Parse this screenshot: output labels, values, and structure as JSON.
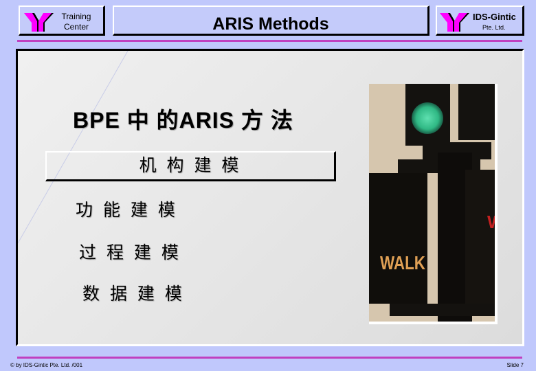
{
  "header": {
    "left_logo_label_line1": "Training",
    "left_logo_label_line2": "Center",
    "title": "ARIS Methods",
    "right_logo_title": "IDS-Gintic",
    "right_logo_subtitle": "Pte. Ltd.",
    "logo_icon": "ids-gintic-y-logo-icon"
  },
  "slide": {
    "heading": "BPE  中 的ARIS 方 法",
    "highlighted_item": "机 构  建 模",
    "items": [
      "功 能  建 模",
      "过 程  建 模",
      "数 据 建 模"
    ],
    "photo": {
      "description": "traffic-signal-photo",
      "walk_sign_text": "WALK"
    }
  },
  "footer": {
    "copyright": "© by IDS-Gintic Pte. Ltd. /001",
    "slide_number": "Slide 7"
  },
  "colors": {
    "background": "#c0c8fc",
    "accent_line": "#c040c0",
    "logo_magenta": "#ff00ff"
  }
}
